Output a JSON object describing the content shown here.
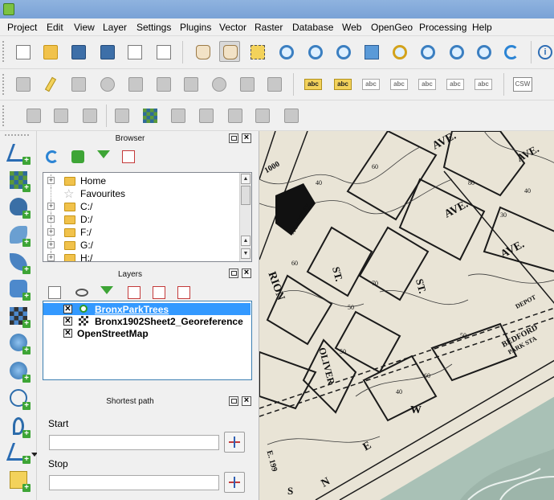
{
  "menubar": {
    "items": [
      "Project",
      "Edit",
      "View",
      "Layer",
      "Settings",
      "Plugins",
      "Vector",
      "Raster",
      "Database",
      "Web",
      "OpenGeo",
      "Processing",
      "Help"
    ]
  },
  "toolbar_labels": {
    "abc": "abc",
    "csw": "CSW",
    "info": "i"
  },
  "browser": {
    "title": "Browser",
    "items": [
      {
        "label": "Home",
        "expander": "+",
        "icon": "folder-icon"
      },
      {
        "label": "Favourites",
        "expander": "",
        "icon": "star-icon"
      },
      {
        "label": "C:/",
        "expander": "+",
        "icon": "folder-icon"
      },
      {
        "label": "D:/",
        "expander": "+",
        "icon": "folder-icon"
      },
      {
        "label": "F:/",
        "expander": "+",
        "icon": "folder-icon"
      },
      {
        "label": "G:/",
        "expander": "+",
        "icon": "folder-icon"
      },
      {
        "label": "H:/",
        "expander": "+",
        "icon": "folder-icon"
      }
    ]
  },
  "layers": {
    "title": "Layers",
    "items": [
      {
        "name": "BronxParkTrees",
        "checked": true,
        "type": "vector",
        "selected": true
      },
      {
        "name": "Bronx1902Sheet2_Georeference",
        "checked": true,
        "type": "raster",
        "selected": false
      },
      {
        "name": "OpenStreetMap",
        "checked": true,
        "type": "none",
        "selected": false
      }
    ]
  },
  "shortest_path": {
    "title": "Shortest path",
    "start_label": "Start",
    "start_value": "",
    "stop_label": "Stop",
    "stop_value": ""
  },
  "map": {
    "labels": [
      "1000",
      "AVE.",
      "AVE.",
      "AVE.",
      "AVE.",
      "RION",
      "ST.",
      "ST.",
      "OLIVER",
      "BEDFORD",
      "PARK STA",
      "DEPOT",
      "ACADEMY",
      "W",
      "N",
      "E",
      "E. 199",
      "S"
    ],
    "contour_numbers": [
      "40",
      "60",
      "80",
      "50",
      "60",
      "70",
      "50",
      "40",
      "60",
      "50",
      "30",
      "40"
    ]
  },
  "colors": {
    "titlebar": "#7aa2d6",
    "selection": "#3399ff",
    "map_paper": "#e9e4d6",
    "map_park": "#a9c1b6"
  }
}
